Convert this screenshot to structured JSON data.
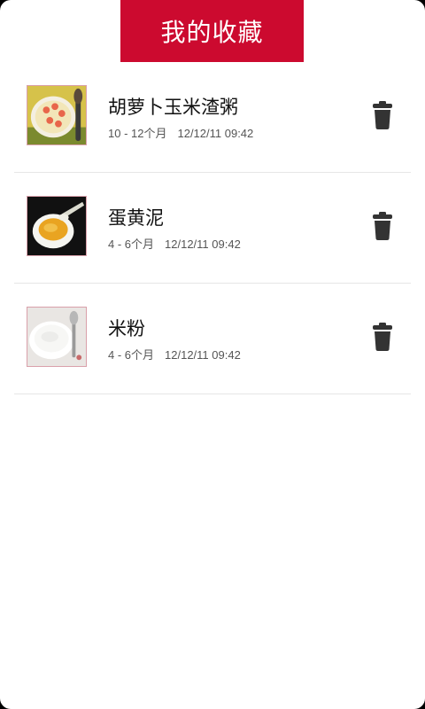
{
  "header": {
    "title": "我的收藏"
  },
  "favorites": [
    {
      "name": "胡萝卜玉米渣粥",
      "age": "10 - 12个月",
      "date": "12/12/11 09:42",
      "image_icon": "carrot-corn-porridge-photo"
    },
    {
      "name": "蛋黄泥",
      "age": "4 - 6个月",
      "date": "12/12/11 09:42",
      "image_icon": "egg-yolk-puree-photo"
    },
    {
      "name": "米粉",
      "age": "4 - 6个月",
      "date": "12/12/11 09:42",
      "image_icon": "rice-cereal-photo"
    }
  ],
  "icons": {
    "delete": "trash-icon"
  },
  "colors": {
    "accent": "#cc0a2f",
    "divider": "#e6e6e6",
    "icon": "#333333"
  }
}
